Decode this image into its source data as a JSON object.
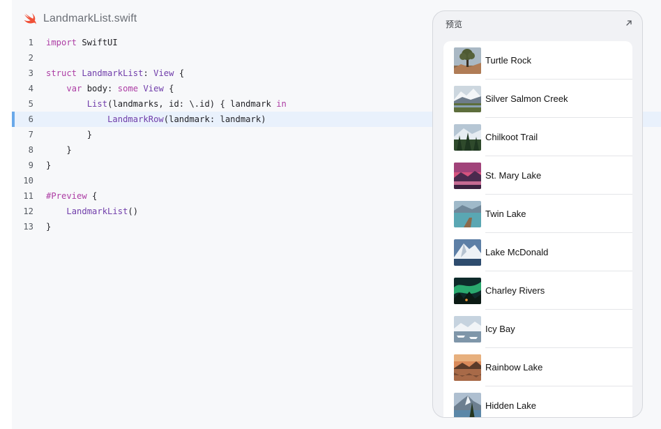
{
  "file": {
    "name": "LandmarkList.swift",
    "icon": "swift-logo-icon"
  },
  "code": {
    "lines": [
      {
        "n": "1",
        "tokens": [
          [
            "kw",
            "import"
          ],
          [
            "",
            "&nbsp;SwiftUI"
          ]
        ]
      },
      {
        "n": "2",
        "tokens": []
      },
      {
        "n": "3",
        "tokens": [
          [
            "kw",
            "struct"
          ],
          [
            "",
            " "
          ],
          [
            "ty",
            "LandmarkList"
          ],
          [
            "",
            ": "
          ],
          [
            "ty",
            "View"
          ],
          [
            "",
            " {"
          ]
        ]
      },
      {
        "n": "4",
        "tokens": [
          [
            "",
            "    "
          ],
          [
            "kw",
            "var"
          ],
          [
            "",
            " body: "
          ],
          [
            "kw",
            "some"
          ],
          [
            "",
            " "
          ],
          [
            "ty",
            "View"
          ],
          [
            "",
            " {"
          ]
        ]
      },
      {
        "n": "5",
        "tokens": [
          [
            "",
            "        "
          ],
          [
            "ty",
            "List"
          ],
          [
            "",
            "(landmarks, id: \\.id) { landmark "
          ],
          [
            "kw",
            "in"
          ]
        ]
      },
      {
        "n": "6",
        "tokens": [
          [
            "",
            "            "
          ],
          [
            "ty",
            "LandmarkRow"
          ],
          [
            "",
            "(landmark: landmark)"
          ]
        ],
        "highlight": true
      },
      {
        "n": "7",
        "tokens": [
          [
            "",
            "        }"
          ]
        ]
      },
      {
        "n": "8",
        "tokens": [
          [
            "",
            "    }"
          ]
        ]
      },
      {
        "n": "9",
        "tokens": [
          [
            "",
            "}"
          ]
        ]
      },
      {
        "n": "10",
        "tokens": []
      },
      {
        "n": "11",
        "tokens": [
          [
            "kw",
            "#Preview"
          ],
          [
            "",
            " {"
          ]
        ]
      },
      {
        "n": "12",
        "tokens": [
          [
            "",
            "    "
          ],
          [
            "ty",
            "LandmarkList"
          ],
          [
            "",
            "()"
          ]
        ]
      },
      {
        "n": "13",
        "tokens": [
          [
            "",
            "}"
          ]
        ]
      }
    ]
  },
  "preview": {
    "title": "预览",
    "expand_icon": "expand-arrow-icon",
    "items": [
      {
        "label": "Turtle Rock",
        "thumb": "desert"
      },
      {
        "label": "Silver Salmon Creek",
        "thumb": "creek"
      },
      {
        "label": "Chilkoot Trail",
        "thumb": "forest"
      },
      {
        "label": "St. Mary Lake",
        "thumb": "sunset"
      },
      {
        "label": "Twin Lake",
        "thumb": "lake"
      },
      {
        "label": "Lake McDonald",
        "thumb": "mountain"
      },
      {
        "label": "Charley Rivers",
        "thumb": "aurora"
      },
      {
        "label": "Icy Bay",
        "thumb": "icy"
      },
      {
        "label": "Rainbow Lake",
        "thumb": "rainbow"
      },
      {
        "label": "Hidden Lake",
        "thumb": "hidden"
      }
    ]
  },
  "colors": {
    "keyword": "#ad3da4",
    "type": "#703daa",
    "highlight": "#e9f1fc",
    "gutter_marker": "#6aa9ea"
  }
}
